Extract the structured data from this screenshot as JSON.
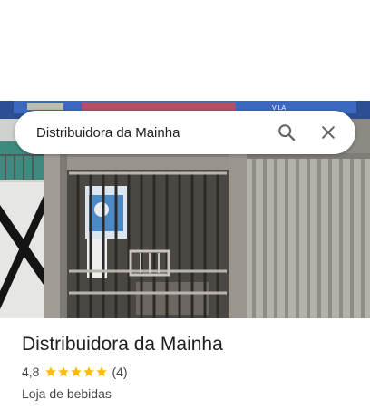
{
  "search": {
    "value": "Distribuidora da Mainha",
    "search_icon": "search-icon",
    "close_icon": "close-icon"
  },
  "photo": {
    "sign_text": "VILA"
  },
  "place": {
    "name": "Distribuidora da Mainha",
    "rating": "4,8",
    "stars": 5,
    "review_count": "(4)",
    "category": "Loja de bebidas"
  },
  "colors": {
    "star": "#fbbc04",
    "title": "#1f1f1f",
    "secondary_text": "#474747",
    "icon": "#5f6368"
  }
}
